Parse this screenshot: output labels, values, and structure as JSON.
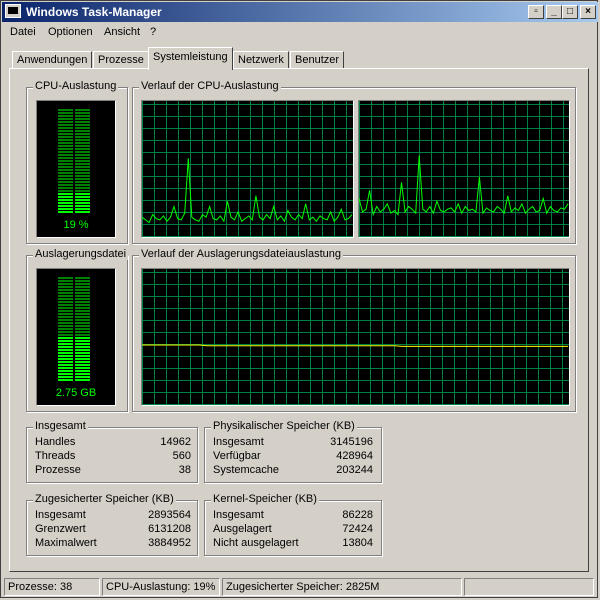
{
  "window": {
    "title": "Windows Task-Manager"
  },
  "menu": [
    "Datei",
    "Optionen",
    "Ansicht",
    "?"
  ],
  "tabs": [
    "Anwendungen",
    "Prozesse",
    "Systemleistung",
    "Netzwerk",
    "Benutzer"
  ],
  "active_tab": "Systemleistung",
  "cpu": {
    "group_label": "CPU-Auslastung",
    "value_text": "19 %",
    "level": 0.19
  },
  "cpu_history": {
    "group_label": "Verlauf der CPU-Auslastung",
    "core1": [
      14,
      12,
      10,
      16,
      13,
      12,
      15,
      11,
      14,
      22,
      13,
      12,
      17,
      58,
      14,
      12,
      11,
      16,
      14,
      22,
      13,
      12,
      15,
      11,
      26,
      14,
      12,
      18,
      11,
      13,
      15,
      12,
      30,
      14,
      12,
      16,
      13,
      22,
      12,
      15,
      11,
      19,
      14,
      12,
      16,
      13,
      24,
      12,
      14,
      11,
      15,
      13,
      12,
      18,
      11,
      14,
      20,
      12,
      13,
      16
    ],
    "core2": [
      28,
      18,
      20,
      34,
      16,
      22,
      18,
      20,
      24,
      17,
      19,
      16,
      40,
      18,
      22,
      20,
      17,
      60,
      20,
      18,
      22,
      17,
      26,
      19,
      18,
      20,
      21,
      18,
      24,
      17,
      22,
      19,
      20,
      18,
      44,
      17,
      21,
      19,
      18,
      22,
      20,
      17,
      30,
      18,
      21,
      19,
      24,
      17,
      20,
      22,
      18,
      19,
      28,
      17,
      22,
      19,
      18,
      21,
      20,
      24
    ]
  },
  "pagefile": {
    "group_label": "Auslagerungsdatei",
    "value_text": "2.75 GB",
    "level": 0.43
  },
  "pagefile_history": {
    "group_label": "Verlauf der Auslagerungsdateiauslastung",
    "values": [
      44,
      44,
      44,
      44,
      44,
      44,
      44,
      44,
      44,
      43.5,
      43.5,
      43.5,
      43.5,
      43.5,
      43.5,
      43.5,
      43.5,
      43.5,
      43.5,
      43.5,
      43.5,
      43.5,
      43.5,
      43.5,
      43.5,
      43.5,
      43.5,
      43.5,
      43.5,
      43.5,
      43.5,
      43.5,
      43.5,
      43.5,
      43.5,
      43.5,
      43,
      43,
      43,
      43,
      43,
      43,
      43,
      43,
      43,
      43,
      43,
      43,
      43,
      43,
      43,
      43,
      43,
      43,
      43,
      43,
      43,
      43,
      43,
      43
    ]
  },
  "totals": {
    "group_label": "Insgesamt",
    "rows": [
      {
        "label": "Handles",
        "value": "14962"
      },
      {
        "label": "Threads",
        "value": "560"
      },
      {
        "label": "Prozesse",
        "value": "38"
      }
    ]
  },
  "physical": {
    "group_label": "Physikalischer Speicher (KB)",
    "rows": [
      {
        "label": "Insgesamt",
        "value": "3145196"
      },
      {
        "label": "Verfügbar",
        "value": "428964"
      },
      {
        "label": "Systemcache",
        "value": "203244"
      }
    ]
  },
  "commit": {
    "group_label": "Zugesicherter Speicher (KB)",
    "rows": [
      {
        "label": "Insgesamt",
        "value": "2893564"
      },
      {
        "label": "Grenzwert",
        "value": "6131208"
      },
      {
        "label": "Maximalwert",
        "value": "3884952"
      }
    ]
  },
  "kernel": {
    "group_label": "Kernel-Speicher (KB)",
    "rows": [
      {
        "label": "Insgesamt",
        "value": "86228"
      },
      {
        "label": "Ausgelagert",
        "value": "72424"
      },
      {
        "label": "Nicht ausgelagert",
        "value": "13804"
      }
    ]
  },
  "status": {
    "processes": "Prozesse: 38",
    "cpu": "CPU-Auslastung: 19%",
    "commit": "Zugesicherter Speicher: 2825M"
  },
  "colors": {
    "meter_on": "#00ff00",
    "meter_off": "#008000",
    "graph_grid": "#008040",
    "graph_line": "#00ff00",
    "pagefile_line": "#ffff00",
    "title_start": "#0a246a",
    "title_end": "#a6caf0"
  }
}
